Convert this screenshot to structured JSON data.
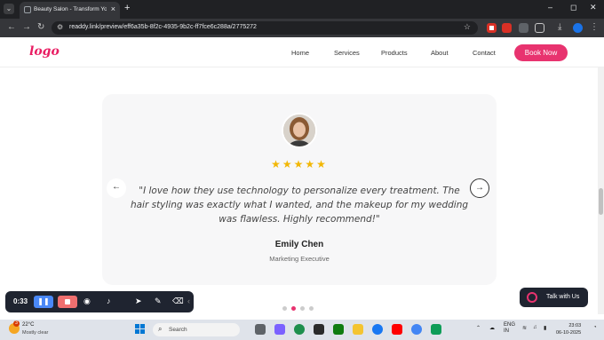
{
  "browser": {
    "tab_title": "Beauty Salon - Transform Your Beauty",
    "url": "readdy.link/preview/eff6a35b-8f2c-4935-9b2c-ff7fce6c288a/2775272",
    "window_controls": {
      "minimize": "–",
      "maximize": "◻",
      "close": "✕"
    }
  },
  "site": {
    "logo": "logo",
    "nav": [
      "Home",
      "Services",
      "Products",
      "About",
      "Contact"
    ],
    "cta": "Book Now"
  },
  "testimonial": {
    "rating": 5,
    "stars": "★★★★★",
    "quote": "\"I love how they use technology to personalize every treatment. The hair styling was exactly what I wanted, and the makeup for my wedding was flawless. Highly recommend!\"",
    "name": "Emily Chen",
    "role": "Marketing Executive",
    "prev_icon": "←",
    "next_icon": "→",
    "slides": 4,
    "active_slide": 2
  },
  "recorder": {
    "time": "0:33",
    "pause_icon": "❚❚"
  },
  "chat_widget": {
    "label": "Talk with Us"
  },
  "taskbar": {
    "weather_temp": "22°C",
    "weather_cond": "Mostly clear",
    "weather_badge": "3",
    "search_placeholder": "Search",
    "lang_top": "ENG",
    "lang_bottom": "IN",
    "time": "23:03",
    "date": "06-10-2025"
  }
}
